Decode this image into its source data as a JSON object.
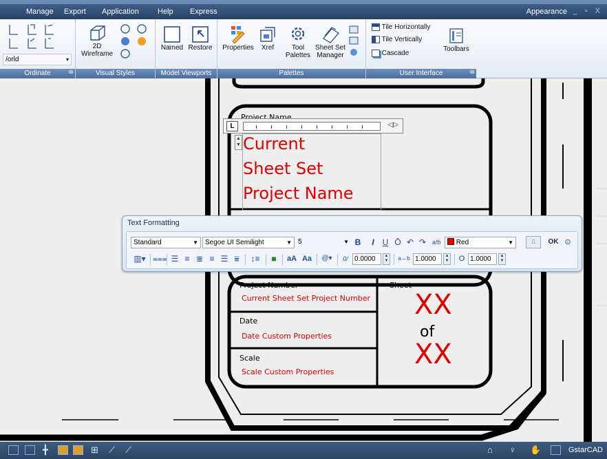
{
  "menu": [
    "Manage",
    "Export",
    "Application",
    "Help",
    "Express"
  ],
  "window": {
    "appearance_label": "Appearance",
    "controls": "_ ▫ X"
  },
  "ribbon": {
    "ordinate": {
      "label": "Ordinate",
      "ucs_combo_value": "/orld"
    },
    "visual_styles": {
      "label": "Visual Styles",
      "wireframe_line1": "2D",
      "wireframe_line2": "Wireframe"
    },
    "model_viewports": {
      "label": "Model Viewports",
      "named": "Named",
      "restore": "Restore"
    },
    "palettes": {
      "label": "Palettes",
      "properties": "Properties",
      "xref": "Xref",
      "tool_line1": "Tool",
      "tool_line2": "Palettes",
      "sheetset_line1": "Sheet Set",
      "sheetset_line2": "Manager"
    },
    "user_interface": {
      "label": "User Interface",
      "tile_horizontally": "Tile Horizontally",
      "tile_vertically": "Tile Vertically",
      "cascade": "Cascade",
      "toolbars": "Toolbars"
    }
  },
  "drawing": {
    "project_name_label": "Project Name",
    "mtext_lines": [
      "Current",
      "Sheet Set",
      "Project Name"
    ],
    "project_number_label": "Project Number",
    "project_number_value": "Current Sheet Set Project Number",
    "date_label": "Date",
    "date_value": "Date Custom Properties",
    "scale_label": "Scale",
    "scale_value": "Scale Custom Properties",
    "sheet_label": "Sheet",
    "sheet_num": "XX",
    "sheet_of": "of",
    "sheet_total": "XX"
  },
  "ruler": {
    "tab_selector": "L",
    "arrows": "◁▷"
  },
  "text_formatting": {
    "title": "Text Formatting",
    "style": "Standard",
    "font": "Segoe UI Semilight",
    "height": "5",
    "bold": "B",
    "italic": "I",
    "underline": "U",
    "overline": "Ō",
    "undo": "↶",
    "redo": "↷",
    "stack": "a/b",
    "color": "Red",
    "ok": "OK",
    "oblique_label": "0/",
    "oblique_value": "0.0000",
    "tracking_label": "a↔b",
    "tracking_value": "1.0000",
    "width_label": "O",
    "width_value": "1.0000",
    "symbol": "@▾",
    "case_upper": "aA",
    "case_lower": "Aa"
  },
  "status": {
    "app_name": "GstarCAD"
  },
  "colors": {
    "accent": "#e00000",
    "ribbon_label": "#4b6d9c",
    "titlebar": "#2a4468"
  }
}
